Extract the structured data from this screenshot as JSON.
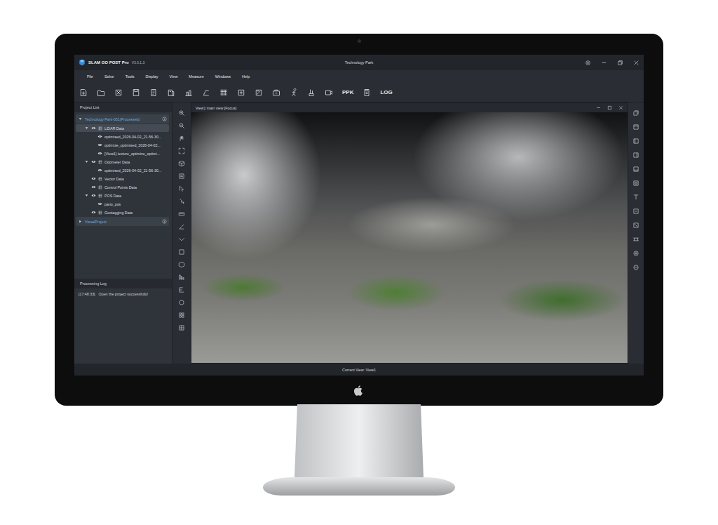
{
  "window": {
    "app_name": "SLAM GO POST Pro",
    "version": "V3.0.1.3",
    "title": "Technology Park"
  },
  "menu": [
    "File",
    "Solve",
    "Tools",
    "Display",
    "View",
    "Measure",
    "Windows",
    "Help"
  ],
  "toolbar": [
    {
      "kind": "icon"
    },
    {
      "kind": "icon"
    },
    {
      "kind": "icon"
    },
    {
      "kind": "icon"
    },
    {
      "kind": "icon"
    },
    {
      "kind": "icon"
    },
    {
      "kind": "icon"
    },
    {
      "kind": "icon"
    },
    {
      "kind": "icon"
    },
    {
      "kind": "icon"
    },
    {
      "kind": "icon"
    },
    {
      "kind": "icon"
    },
    {
      "kind": "icon"
    },
    {
      "kind": "icon"
    },
    {
      "kind": "icon"
    },
    {
      "kind": "text",
      "label": "PPK"
    },
    {
      "kind": "icon"
    },
    {
      "kind": "text",
      "label": "LOG"
    }
  ],
  "project_panel": {
    "title": "Project List",
    "tree": [
      {
        "label": "Technology Park-001(Processed)",
        "depth": 0,
        "kind": "project",
        "expanded": true,
        "selected": false
      },
      {
        "label": "LiDAR Data",
        "depth": 1,
        "kind": "group",
        "expanded": true,
        "selected": true
      },
      {
        "label": "optimised_2026-04-02_21-56-30...",
        "depth": 2,
        "kind": "file",
        "expanded": false,
        "selected": false
      },
      {
        "label": "optimize_optimised_2026-04-02...",
        "depth": 2,
        "kind": "file",
        "expanded": false,
        "selected": false
      },
      {
        "label": "[View1] texture_optimize_optimi...",
        "depth": 2,
        "kind": "file",
        "expanded": false,
        "selected": false
      },
      {
        "label": "Odometer Data",
        "depth": 1,
        "kind": "group",
        "expanded": true,
        "selected": false
      },
      {
        "label": "optimised_2026-04-02_21-56-30...",
        "depth": 2,
        "kind": "file",
        "expanded": false,
        "selected": false
      },
      {
        "label": "Vector Data",
        "depth": 1,
        "kind": "leaf-group",
        "expanded": false,
        "selected": false
      },
      {
        "label": "Control Points Data",
        "depth": 1,
        "kind": "leaf-group",
        "expanded": false,
        "selected": false
      },
      {
        "label": "POS Data",
        "depth": 1,
        "kind": "group",
        "expanded": true,
        "selected": false
      },
      {
        "label": "pano_pos",
        "depth": 2,
        "kind": "file",
        "expanded": false,
        "selected": false
      },
      {
        "label": "Geotagging Data",
        "depth": 1,
        "kind": "leaf-group",
        "expanded": false,
        "selected": false
      },
      {
        "label": "VisualProject",
        "depth": 0,
        "kind": "project",
        "expanded": false,
        "selected": false
      }
    ]
  },
  "log_panel": {
    "title": "Processing Log",
    "entries": [
      {
        "time": "[17:48:33]",
        "message": "Open the project successfully!"
      }
    ]
  },
  "view": {
    "title": "View1 main view [Focus]"
  },
  "status_bar": {
    "text": "Current View: View1"
  }
}
